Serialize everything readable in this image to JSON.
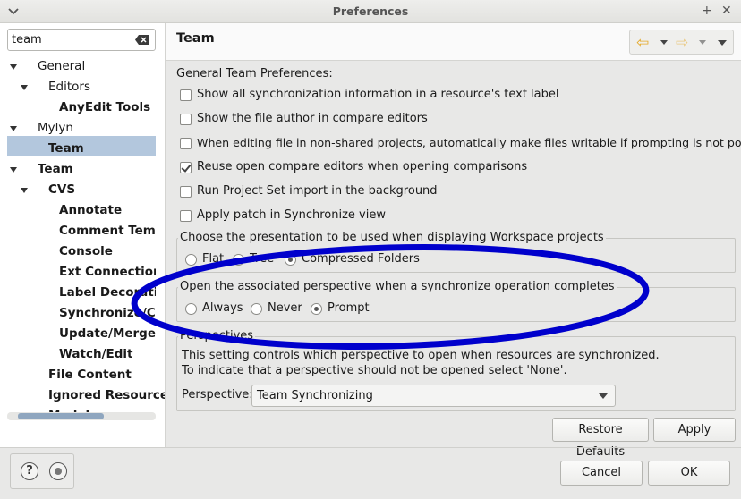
{
  "window": {
    "title": "Preferences",
    "maximize_glyph": "+",
    "close_glyph": "✕"
  },
  "search": {
    "value": "team",
    "clear_icon": "backspace-clear-icon"
  },
  "tree": {
    "items": [
      {
        "label": "General",
        "expanded": true
      },
      {
        "label": "Editors",
        "expanded": true
      },
      {
        "label": "AnyEdit Tools"
      },
      {
        "label": "Mylyn",
        "expanded": true
      },
      {
        "label": "Team"
      },
      {
        "label": "Team",
        "expanded": true,
        "selected": true
      },
      {
        "label": "CVS",
        "expanded": true
      },
      {
        "label": "Annotate"
      },
      {
        "label": "Comment Templ"
      },
      {
        "label": "Console"
      },
      {
        "label": "Ext Connection M"
      },
      {
        "label": "Label Decoratio"
      },
      {
        "label": "Synchronize/Com"
      },
      {
        "label": "Update/Merge"
      },
      {
        "label": "Watch/Edit"
      },
      {
        "label": "File Content"
      },
      {
        "label": "Ignored Resources"
      },
      {
        "label": "Models"
      }
    ]
  },
  "page": {
    "title": "Team",
    "nav_back_icon": "back-arrow-icon",
    "nav_forward_icon": "forward-arrow-icon",
    "menu_icon": "view-menu-icon"
  },
  "general": {
    "heading": "General Team Preferences:",
    "options": [
      {
        "label": "Show all synchronization information in a resource's text label",
        "checked": false
      },
      {
        "label": "Show the file author in compare editors",
        "checked": false
      },
      {
        "label": "When editing file in non-shared projects, automatically make files writable if prompting is not possible",
        "checked": false
      },
      {
        "label": "Reuse open compare editors when opening comparisons",
        "checked": true
      },
      {
        "label": "Run Project Set import in the background",
        "checked": false
      },
      {
        "label": "Apply patch in Synchronize view",
        "checked": false
      }
    ]
  },
  "presentation": {
    "legend": "Choose the presentation to be used when displaying Workspace projects",
    "options": [
      {
        "label": "Flat",
        "selected": false
      },
      {
        "label": "Tree",
        "selected": false
      },
      {
        "label": "Compressed Folders",
        "selected": true
      }
    ]
  },
  "perspective_open": {
    "legend": "Open the associated perspective when a synchronize operation completes",
    "options": [
      {
        "label": "Always",
        "selected": false
      },
      {
        "label": "Never",
        "selected": false
      },
      {
        "label": "Prompt",
        "selected": true
      }
    ]
  },
  "perspectives": {
    "legend": "Perspectives",
    "desc1": "This setting controls which perspective to open when resources are synchronized.",
    "desc2": "To indicate that a perspective should not be opened select 'None'.",
    "label": "Perspective:",
    "value": "Team Synchronizing"
  },
  "buttons": {
    "restore_defaults": "Restore Defaults",
    "apply": "Apply",
    "cancel": "Cancel",
    "ok": "OK"
  },
  "footer": {
    "help_icon": "help-icon",
    "help_glyph": "?",
    "tray_icon": "record-icon"
  },
  "annotation": {
    "color": "#0000cc",
    "shape": "hand-drawn-ellipse"
  }
}
